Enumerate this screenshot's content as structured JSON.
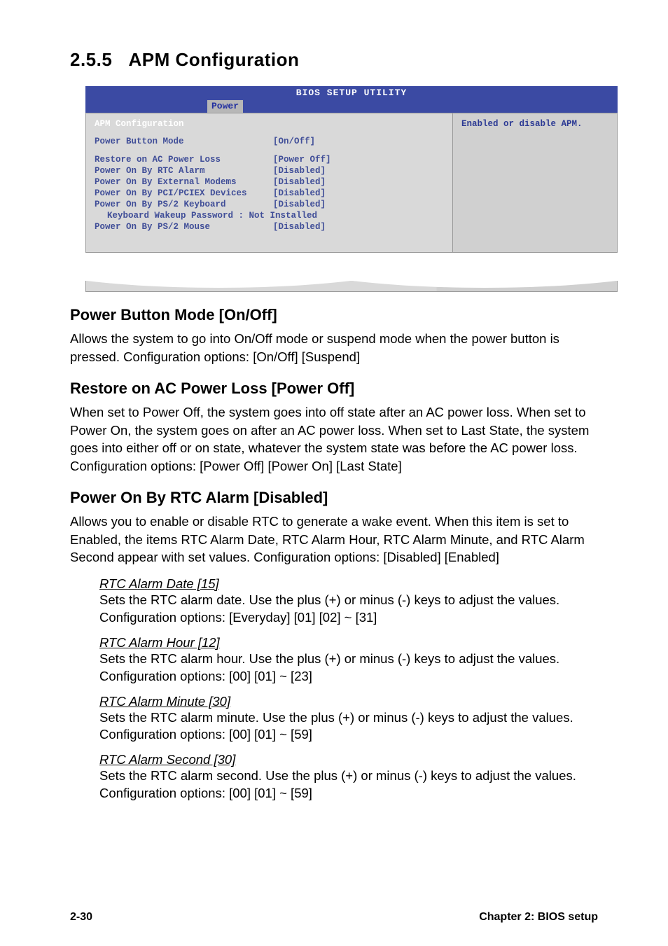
{
  "section": {
    "number": "2.5.5",
    "title": "APM Configuration"
  },
  "bios": {
    "topbar": "BIOS SETUP UTILITY",
    "tab": "Power",
    "header": "APM Configuration",
    "help": "Enabled or disable APM.",
    "rows": [
      {
        "label": "Power Button Mode",
        "value": "[On/Off]"
      }
    ],
    "rows2": [
      {
        "label": "Restore on AC Power Loss",
        "value": "[Power Off]"
      },
      {
        "label": "Power On By RTC Alarm",
        "value": "[Disabled]"
      },
      {
        "label": "Power On By External Modems",
        "value": "[Disabled]"
      },
      {
        "label": "Power On By PCI/PCIEX Devices",
        "value": "[Disabled]"
      },
      {
        "label": "Power On By PS/2 Keyboard",
        "value": "[Disabled]"
      },
      {
        "label": "Keyboard Wakeup Password : Not Installed",
        "value": "",
        "indent": true
      },
      {
        "label": "Power On By PS/2 Mouse",
        "value": "[Disabled]"
      }
    ]
  },
  "items": [
    {
      "title": "Power Button Mode [On/Off]",
      "body": "Allows the system to go into On/Off mode or suspend mode when the power button is pressed. Configuration options: [On/Off] [Suspend]"
    },
    {
      "title": "Restore on AC Power Loss [Power Off]",
      "body": "When set to Power Off, the system goes into off state after an AC power loss. When set to Power On, the system goes on after an AC power loss. When set to Last State, the system goes into either off or on state, whatever the system state was before the AC power loss. Configuration options: [Power Off] [Power On] [Last State]"
    },
    {
      "title": "Power On By RTC Alarm [Disabled]",
      "body": "Allows you to enable or disable RTC to generate a wake event. When this item is set to Enabled, the items RTC Alarm Date, RTC Alarm Hour, RTC Alarm Minute, and RTC Alarm Second appear with set values. Configuration options: [Disabled] [Enabled]"
    }
  ],
  "subs": [
    {
      "title": "RTC Alarm Date [15]",
      "body": "Sets the RTC alarm date. Use the plus (+) or minus (-) keys to adjust the values. Configuration options: [Everyday] [01] [02] ~ [31]"
    },
    {
      "title": "RTC Alarm Hour [12]",
      "body": "Sets the RTC alarm hour. Use the plus (+) or minus (-) keys to adjust the values. Configuration options: [00] [01] ~ [23]"
    },
    {
      "title": "RTC Alarm Minute [30]",
      "body": "Sets the RTC alarm minute. Use the plus (+) or minus (-) keys to adjust the values. Configuration options: [00] [01] ~ [59]"
    },
    {
      "title": "RTC Alarm Second [30]",
      "body": "Sets the RTC alarm second. Use the plus (+) or minus (-) keys to adjust the values. Configuration options: [00] [01] ~ [59]"
    }
  ],
  "footer": {
    "left": "2-30",
    "right": "Chapter 2: BIOS setup"
  }
}
